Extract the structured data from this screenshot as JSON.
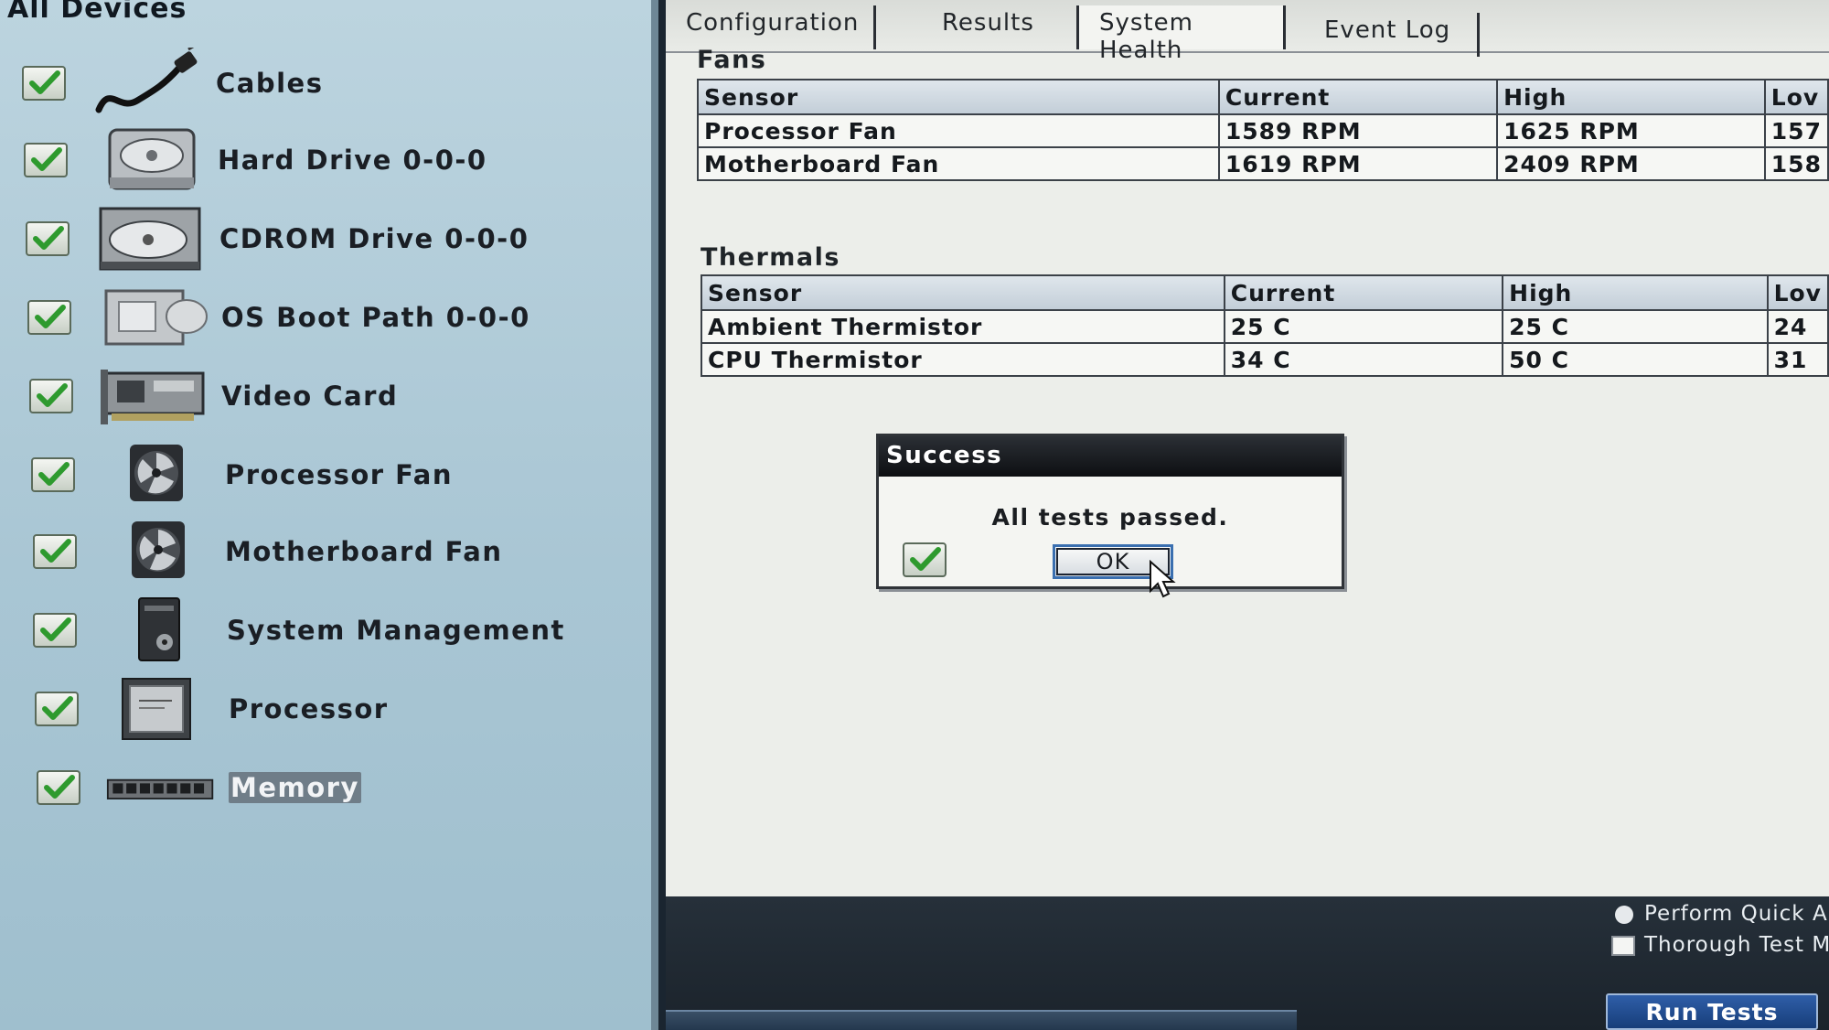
{
  "left_panel": {
    "header": "All Devices",
    "devices": [
      {
        "label": "Cables",
        "icon": "cable-icon",
        "status": "passed"
      },
      {
        "label": "Hard Drive 0-0-0",
        "icon": "hard-drive-icon",
        "status": "passed"
      },
      {
        "label": "CDROM Drive 0-0-0",
        "icon": "cdrom-drive-icon",
        "status": "passed"
      },
      {
        "label": "OS Boot Path 0-0-0",
        "icon": "boot-path-icon",
        "status": "passed"
      },
      {
        "label": "Video Card",
        "icon": "video-card-icon",
        "status": "passed"
      },
      {
        "label": "Processor Fan",
        "icon": "fan-icon",
        "status": "passed"
      },
      {
        "label": "Motherboard Fan",
        "icon": "fan-icon",
        "status": "passed"
      },
      {
        "label": "System Management",
        "icon": "system-management-icon",
        "status": "passed"
      },
      {
        "label": "Processor",
        "icon": "processor-icon",
        "status": "passed"
      },
      {
        "label": "Memory",
        "icon": "memory-icon",
        "status": "passed",
        "selected": true
      }
    ]
  },
  "tabs": [
    {
      "label": "Configuration",
      "active": false
    },
    {
      "label": "Results",
      "active": false
    },
    {
      "label": "System Health",
      "active": true
    },
    {
      "label": "Event Log",
      "active": false
    }
  ],
  "fans": {
    "title": "Fans",
    "columns": [
      "Sensor",
      "Current",
      "High",
      "Lov"
    ],
    "rows": [
      [
        "Processor Fan",
        "1589 RPM",
        "1625 RPM",
        "157"
      ],
      [
        "Motherboard Fan",
        "1619 RPM",
        "2409 RPM",
        "158"
      ]
    ]
  },
  "thermals": {
    "title": "Thermals",
    "columns": [
      "Sensor",
      "Current",
      "High",
      "Lov"
    ],
    "rows": [
      [
        "Ambient Thermistor",
        "25 C",
        "25 C",
        "24"
      ],
      [
        "CPU Thermistor",
        "34 C",
        "50 C",
        "31"
      ]
    ]
  },
  "dialog": {
    "title": "Success",
    "message": "All tests passed.",
    "ok_label": "OK"
  },
  "bottom": {
    "quick_option": "Perform Quick A",
    "thorough_option": "Thorough Test M",
    "run_tests_label": "Run Tests"
  },
  "colors": {
    "check_green": "#2e9a2e",
    "button_blue": "#1f4b8e",
    "panel_blue": "#a9c6d4"
  }
}
